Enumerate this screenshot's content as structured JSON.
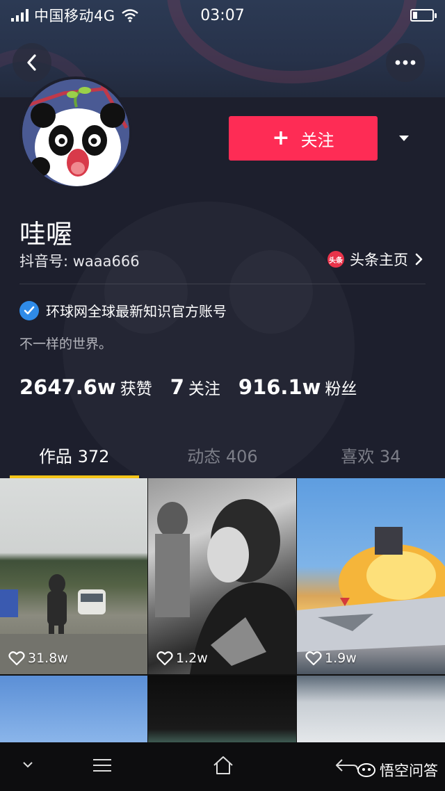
{
  "status_bar": {
    "carrier": "中国移动4G",
    "time": "03:07"
  },
  "profile": {
    "name": "哇喔",
    "douyin_id": "抖音号: waaa666",
    "follow_label": "关注",
    "toutiao_badge": "头条",
    "toutiao_link": "头条主页",
    "verified_text": "环球网全球最新知识官方账号",
    "bio": "不一样的世界。",
    "stats": [
      {
        "num": "2647.6w",
        "label": "获赞"
      },
      {
        "num": "7",
        "label": "关注"
      },
      {
        "num": "916.1w",
        "label": "粉丝"
      }
    ]
  },
  "tabs": [
    {
      "label": "作品 372",
      "active": true
    },
    {
      "label": "动态 406",
      "active": false
    },
    {
      "label": "喜欢 34",
      "active": false
    }
  ],
  "videos": [
    {
      "likes": "31.8w"
    },
    {
      "likes": "1.2w"
    },
    {
      "likes": "1.9w"
    }
  ],
  "source": {
    "label": "悟空问答"
  },
  "colors": {
    "follow_button": "#fe2c55",
    "tab_indicator": "#f5c518",
    "verified_badge": "#2f8be8"
  },
  "icons": {
    "back": "chevron-left-icon",
    "more": "more-dots-icon",
    "dropdown": "triangle-down-icon",
    "chevron": "chevron-right-icon",
    "verified": "check-icon",
    "like": "heart-icon",
    "nav_down": "chevron-down-icon",
    "nav_menu": "menu-icon",
    "nav_home": "home-icon",
    "nav_back": "back-arrow-icon"
  }
}
